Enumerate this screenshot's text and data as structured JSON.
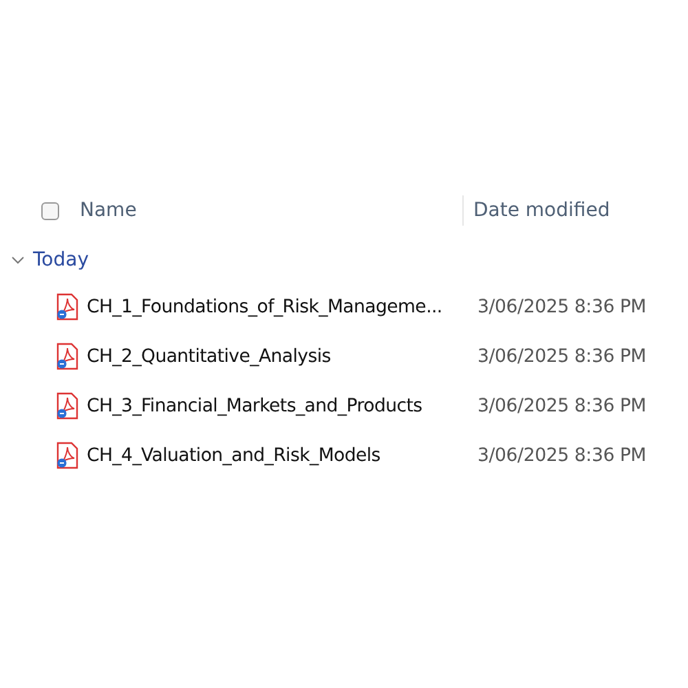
{
  "header": {
    "select_all": {
      "checked": false
    },
    "columns": [
      "Name",
      "Date modified"
    ]
  },
  "groups": [
    {
      "label": "Today",
      "expanded": true,
      "files": [
        {
          "name": "CH_1_Foundations_of_Risk_Manageme...",
          "date_modified": "3/06/2025 8:36 PM"
        },
        {
          "name": "CH_2_Quantitative_Analysis",
          "date_modified": "3/06/2025 8:36 PM"
        },
        {
          "name": "CH_3_Financial_Markets_and_Products",
          "date_modified": "3/06/2025 8:36 PM"
        },
        {
          "name": "CH_4_Valuation_and_Risk_Models",
          "date_modified": "3/06/2025 8:36 PM"
        }
      ]
    }
  ]
}
